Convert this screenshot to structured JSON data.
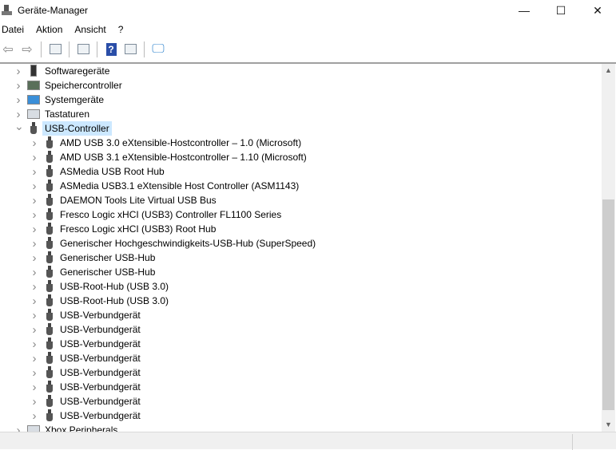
{
  "window": {
    "title": "Geräte-Manager",
    "minimize": "—",
    "maximize": "☐",
    "close": "✕"
  },
  "menu": [
    "Datei",
    "Aktion",
    "Ansicht",
    "?"
  ],
  "toolbar": {
    "help": "?"
  },
  "tree": {
    "categories_before": [
      {
        "label": "Softwaregeräte",
        "icon": "software-device-icon"
      },
      {
        "label": "Speichercontroller",
        "icon": "storage-controller-icon"
      },
      {
        "label": "Systemgeräte",
        "icon": "system-device-icon"
      },
      {
        "label": "Tastaturen",
        "icon": "keyboard-icon"
      }
    ],
    "expanded": {
      "label": "USB-Controller",
      "icon": "usb-icon"
    },
    "children": [
      "AMD USB 3.0 eXtensible-Hostcontroller – 1.0 (Microsoft)",
      "AMD USB 3.1 eXtensible-Hostcontroller – 1.10 (Microsoft)",
      "ASMedia USB Root Hub",
      "ASMedia USB3.1 eXtensible Host Controller (ASM1143)",
      "DAEMON Tools Lite Virtual USB Bus",
      "Fresco Logic xHCI (USB3) Controller FL1100 Series",
      "Fresco Logic xHCI (USB3) Root Hub",
      "Generischer Hochgeschwindigkeits-USB-Hub (SuperSpeed)",
      "Generischer USB-Hub",
      "Generischer USB-Hub",
      "USB-Root-Hub (USB 3.0)",
      "USB-Root-Hub (USB 3.0)",
      "USB-Verbundgerät",
      "USB-Verbundgerät",
      "USB-Verbundgerät",
      "USB-Verbundgerät",
      "USB-Verbundgerät",
      "USB-Verbundgerät",
      "USB-Verbundgerät",
      "USB-Verbundgerät"
    ],
    "categories_after": [
      {
        "label": "Xbox Peripherals",
        "icon": "keyboard-icon"
      }
    ]
  },
  "colors": {
    "selection": "#cce8ff"
  }
}
